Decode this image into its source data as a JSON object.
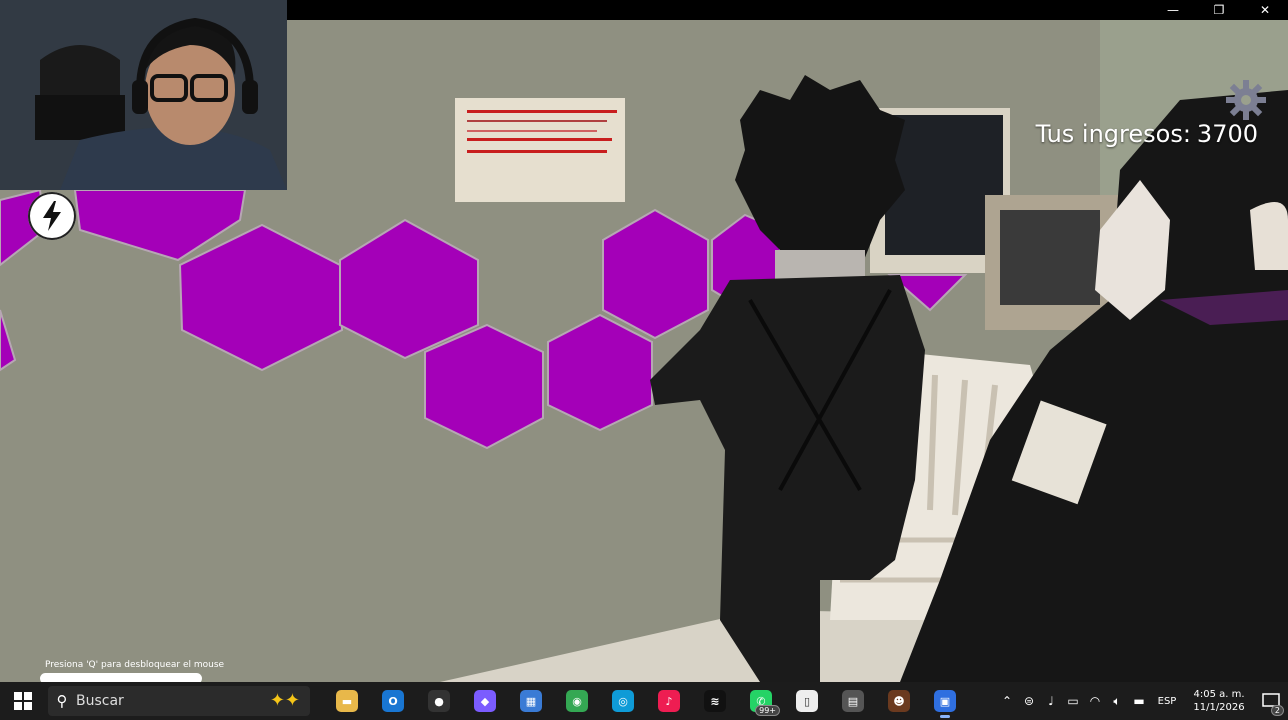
{
  "hud": {
    "income_label": "Tus ingresos:",
    "income_value": "3700",
    "unlock_hint": "Presiona 'Q' para desbloquear el mouse",
    "hexagon_color": "#a400b8"
  },
  "window": {
    "minimize": "—",
    "maximize": "❐",
    "close": "✕"
  },
  "taskbar": {
    "search_placeholder": "Buscar",
    "apps": [
      {
        "name": "file-explorer",
        "color": "#e8b84a",
        "glyph": "▬"
      },
      {
        "name": "outlook",
        "color": "#1976d2",
        "glyph": "O"
      },
      {
        "name": "screen-recorder",
        "color": "#333333",
        "glyph": "●"
      },
      {
        "name": "copilot",
        "color": "#7b5cff",
        "glyph": "◆"
      },
      {
        "name": "ms-store",
        "color": "#3a7bd5",
        "glyph": "▦"
      },
      {
        "name": "chrome",
        "color": "#34a853",
        "glyph": "◉"
      },
      {
        "name": "edge",
        "color": "#0f9bd7",
        "glyph": "◎"
      },
      {
        "name": "tiktok",
        "color": "#ee1d52",
        "glyph": "♪"
      },
      {
        "name": "capcut",
        "color": "#111111",
        "glyph": "≋"
      },
      {
        "name": "whatsapp",
        "color": "#25d366",
        "glyph": "✆",
        "badge": "99+"
      },
      {
        "name": "file",
        "color": "#eeeeee",
        "glyph": "▯"
      },
      {
        "name": "game-app",
        "color": "#555555",
        "glyph": "▤"
      },
      {
        "name": "fnaf",
        "color": "#6b3a1f",
        "glyph": "☻"
      },
      {
        "name": "roblox",
        "color": "#2f6fe0",
        "glyph": "▣",
        "active": true
      }
    ],
    "lang": "ESP",
    "time": "4:05 a. m.",
    "date": "11/1/2026",
    "notifications": "2"
  }
}
